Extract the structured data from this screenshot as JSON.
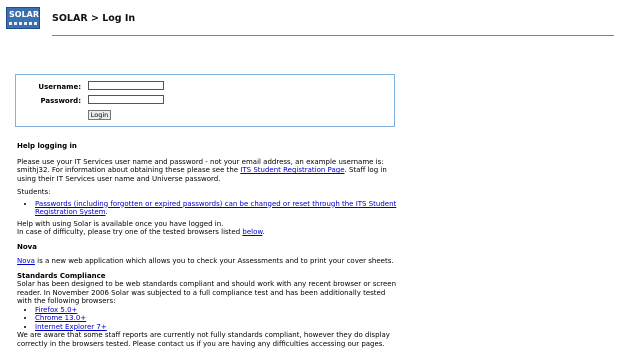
{
  "header": {
    "logo_text": "SOLAR",
    "title": "SOLAR > Log In"
  },
  "login": {
    "username_label": "Username:",
    "password_label": "Password:",
    "username_value": "",
    "password_value": "",
    "login_button": "Login"
  },
  "help": {
    "heading": "Help logging in",
    "p1a": "Please use your IT Services user name and password - not your email address, an example username is: smithj32. For information about obtaining these please see the ",
    "p1_link": "ITS Student Registration Page",
    "p1b": ". Staff log in using their IT Services user name and Universe password.",
    "students_label": "Students:",
    "students_link": "Passwords (including forgotten or expired passwords) can be changed or reset through the ITS Student Registration System",
    "students_tail": ".",
    "p2a": "Help with using Solar is available once you have logged in.",
    "p2b": "In case of difficulty, please try one of the tested browsers listed ",
    "p2_link": "below",
    "p2c": "."
  },
  "nova": {
    "heading": "Nova",
    "link": "Nova",
    "text": " is a new web application which allows you to check your Assessments and to print your cover sheets."
  },
  "standards": {
    "heading": "Standards Compliance",
    "p1": "Solar has been designed to be web standards compliant and should work with any recent browser or screen reader. In November 2006 Solar was subjected to a full compliance test and has been additionally tested with the following browsers:",
    "browsers": [
      "Firefox 5.0+",
      "Chrome 13.0+",
      "Internet Explorer 7+"
    ],
    "p2": "We are aware that some staff reports are currently not fully standards compliant, however they do display correctly in the browsers tested. Please contact us if you are having any difficulties accessing our pages."
  }
}
